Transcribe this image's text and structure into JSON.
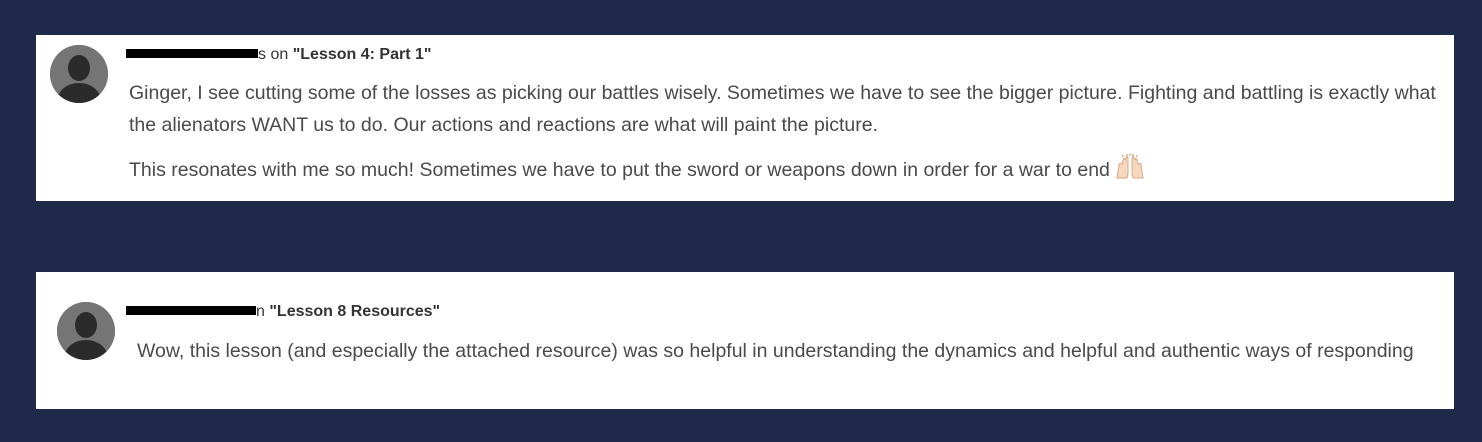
{
  "comments": [
    {
      "author_visible_suffix": "s on ",
      "lesson_title": "\"Lesson 4: Part 1\"",
      "paragraphs": [
        "Ginger, I see cutting some of the losses as picking our battles wisely. Sometimes we have to see the bigger picture. Fighting and battling is exactly what the alienators WANT us to do. Our actions and reactions are what will paint the picture.",
        "This resonates with me so much! Sometimes we have to put the sword or weapons down in order for a war to end"
      ],
      "trailing_icon": "raising-hands-emoji-icon"
    },
    {
      "author_visible_suffix": "n ",
      "lesson_title": "\"Lesson 8 Resources\"",
      "paragraphs": [
        "Wow, this lesson (and especially the attached resource) was so helpful in understanding the dynamics and helpful and authentic ways of responding"
      ]
    }
  ],
  "colors": {
    "background": "#1f2a4a",
    "card": "#ffffff",
    "avatar": "#757575",
    "avatar_silhouette": "#2b2b2b"
  }
}
